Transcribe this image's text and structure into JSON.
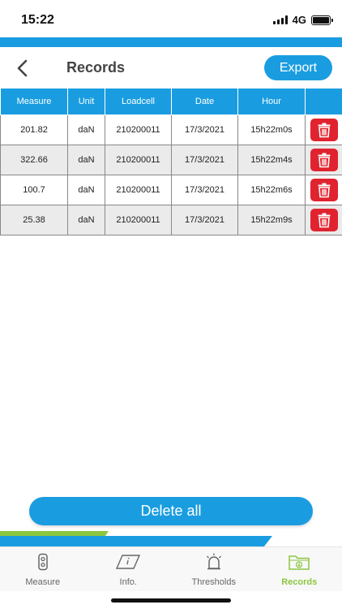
{
  "status_bar": {
    "time": "15:22",
    "network": "4G"
  },
  "header": {
    "title": "Records",
    "export_label": "Export"
  },
  "table": {
    "columns": [
      "Measure",
      "Unit",
      "Loadcell",
      "Date",
      "Hour",
      ""
    ],
    "rows": [
      {
        "measure": "201.82",
        "unit": "daN",
        "loadcell": "210200011",
        "date": "17/3/2021",
        "hour": "15h22m0s"
      },
      {
        "measure": "322.66",
        "unit": "daN",
        "loadcell": "210200011",
        "date": "17/3/2021",
        "hour": "15h22m4s"
      },
      {
        "measure": "100.7",
        "unit": "daN",
        "loadcell": "210200011",
        "date": "17/3/2021",
        "hour": "15h22m6s"
      },
      {
        "measure": "25.38",
        "unit": "daN",
        "loadcell": "210200011",
        "date": "17/3/2021",
        "hour": "15h22m9s"
      }
    ]
  },
  "actions": {
    "delete_all_label": "Delete all"
  },
  "tabs": [
    {
      "label": "Measure",
      "icon": "loadcell-icon",
      "active": false
    },
    {
      "label": "Info.",
      "icon": "info-icon",
      "active": false
    },
    {
      "label": "Thresholds",
      "icon": "alarm-icon",
      "active": false
    },
    {
      "label": "Records",
      "icon": "folder-download-icon",
      "active": true
    }
  ],
  "colors": {
    "primary": "#1a9de0",
    "accent": "#8cc63f",
    "danger": "#e0232e",
    "row_alt": "#ebebeb"
  }
}
